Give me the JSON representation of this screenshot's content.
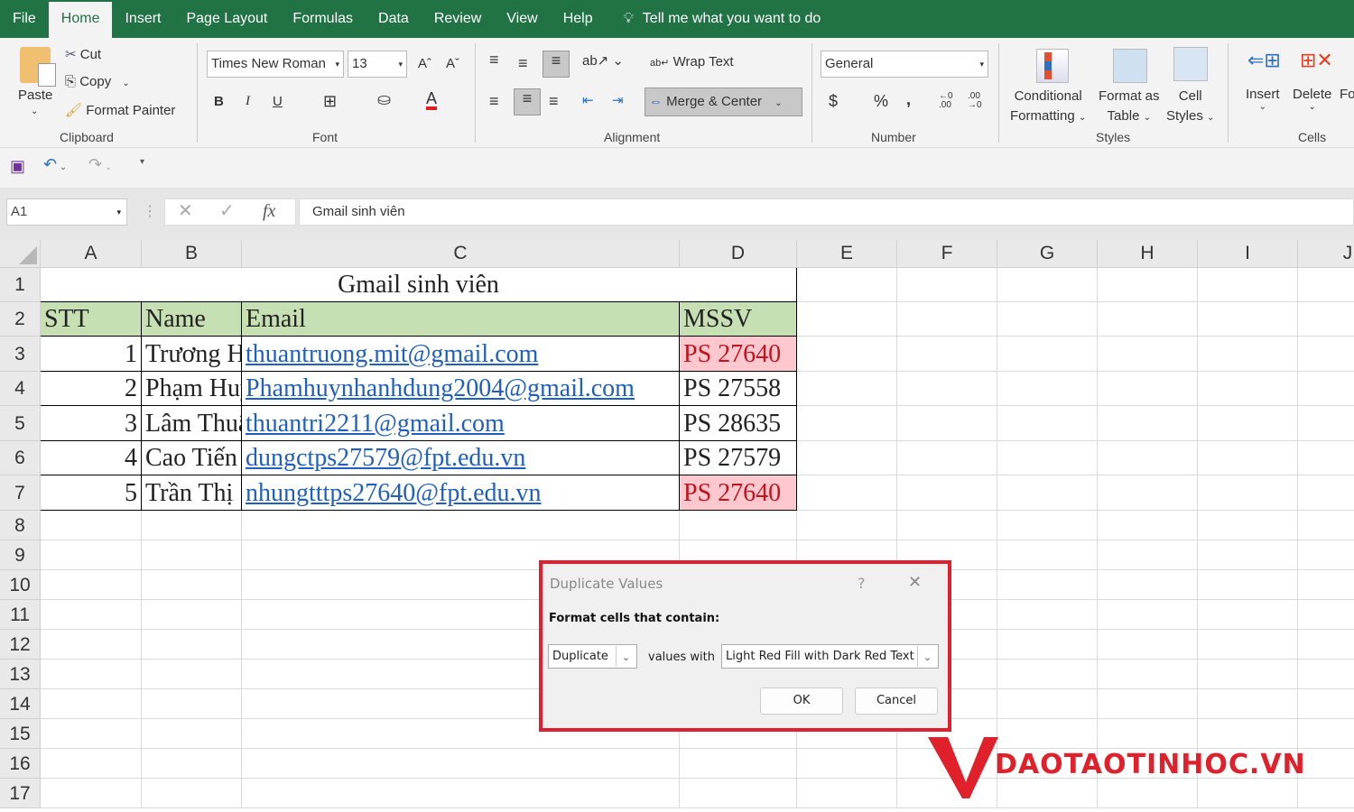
{
  "tabs": [
    "File",
    "Home",
    "Insert",
    "Page Layout",
    "Formulas",
    "Data",
    "Review",
    "View",
    "Help"
  ],
  "tell_me": "Tell me what you want to do",
  "clipboard": {
    "paste": "Paste",
    "cut": "Cut",
    "copy": "Copy",
    "format_painter": "Format Painter",
    "label": "Clipboard"
  },
  "font": {
    "name": "Times New Roman",
    "size": "13",
    "bold": "B",
    "italic": "I",
    "underline": "U",
    "label": "Font",
    "color": "#e02020"
  },
  "alignment": {
    "wrap": "Wrap Text",
    "merge": "Merge & Center",
    "label": "Alignment"
  },
  "number": {
    "format": "General",
    "currency": "$",
    "percent": "%",
    "comma": ",",
    "inc": "←0 .00",
    "dec": ".00 →0",
    "label": "Number"
  },
  "styles": {
    "conditional": [
      "Conditional",
      "Formatting"
    ],
    "format_table": [
      "Format as",
      "Table"
    ],
    "cell_styles": [
      "Cell",
      "Styles"
    ],
    "label": "Styles"
  },
  "cells": {
    "insert": "Insert",
    "delete": "Delete",
    "format": "Fo",
    "label": "Cells"
  },
  "formula_bar": {
    "name_box": "A1",
    "fx": "fx",
    "value": "Gmail sinh viên"
  },
  "columns": [
    "A",
    "B",
    "C",
    "D",
    "E",
    "F",
    "G",
    "H",
    "I",
    "J"
  ],
  "rows": [
    "1",
    "2",
    "3",
    "4",
    "5",
    "6",
    "7",
    "8",
    "9",
    "10",
    "11",
    "12",
    "13",
    "14",
    "15",
    "16",
    "17"
  ],
  "sheet": {
    "title": "Gmail sinh viên",
    "headers": [
      "STT",
      "Name",
      "Email",
      "MSSV"
    ],
    "data": [
      [
        "1",
        "Trương Hoài",
        "thuantruong.mit@gmail.com",
        "PS 27640",
        true
      ],
      [
        "2",
        "Phạm Huy",
        "Phamhuynhanhdung2004@gmail.com",
        "PS 27558",
        false
      ],
      [
        "3",
        "Lâm Thuận",
        "thuantri2211@gmail.com",
        "PS 28635",
        false
      ],
      [
        "4",
        "Cao Tiến",
        "dungctps27579@fpt.edu.vn",
        "PS 27579",
        false
      ],
      [
        "5",
        "Trần Thị",
        "nhungtttps27640@fpt.edu.vn",
        "PS 27640",
        true
      ]
    ],
    "header_fill": "#c6e0b4",
    "dup_fill": "#ffc7ce",
    "dup_text": "#c0151f",
    "link": "#1f5fbf"
  },
  "dialog": {
    "title": "Duplicate Values",
    "help": "?",
    "close": "✕",
    "prompt": "Format cells that contain:",
    "type": "Duplicate",
    "values_with": "values with",
    "format": "Light Red Fill with Dark Red Text",
    "ok": "OK",
    "cancel": "Cancel"
  },
  "watermark": "DAOTAOTINHOC.VN"
}
